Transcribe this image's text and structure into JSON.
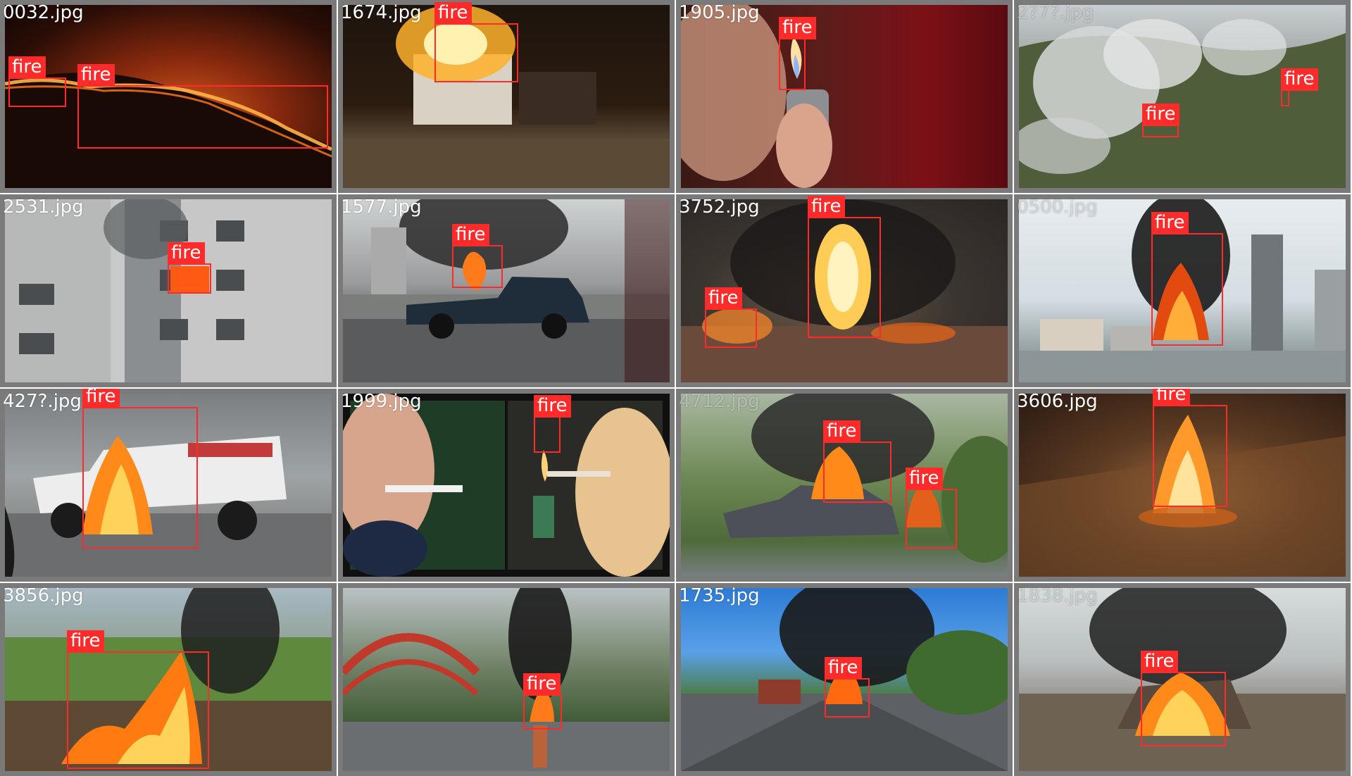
{
  "label_color": "#ff2b2b",
  "tiles": [
    {
      "filename": "0032.jpg",
      "filename_faint": false,
      "detections": [
        {
          "label": "fire"
        },
        {
          "label": "fire"
        }
      ]
    },
    {
      "filename": "1674.jpg",
      "filename_faint": false,
      "detections": [
        {
          "label": "fire"
        }
      ]
    },
    {
      "filename": "1905.jpg",
      "filename_faint": false,
      "detections": [
        {
          "label": "fire"
        }
      ]
    },
    {
      "filename": "2?7?.jpg",
      "filename_faint": true,
      "detections": [
        {
          "label": "fire"
        },
        {
          "label": "fire"
        }
      ]
    },
    {
      "filename": "2531.jpg",
      "filename_faint": false,
      "detections": [
        {
          "label": "fire"
        }
      ]
    },
    {
      "filename": "1577.jpg",
      "filename_faint": false,
      "detections": [
        {
          "label": "fire"
        }
      ]
    },
    {
      "filename": "3752.jpg",
      "filename_faint": false,
      "detections": [
        {
          "label": "fire"
        },
        {
          "label": "fire"
        }
      ]
    },
    {
      "filename": "0500.jpg",
      "filename_faint": true,
      "detections": [
        {
          "label": "fire"
        }
      ]
    },
    {
      "filename": "427?.jpg",
      "filename_faint": false,
      "detections": [
        {
          "label": "fire"
        }
      ]
    },
    {
      "filename": "1999.jpg",
      "filename_faint": false,
      "detections": [
        {
          "label": "fire"
        }
      ]
    },
    {
      "filename": "4712.jpg",
      "filename_faint": true,
      "detections": [
        {
          "label": "fire"
        },
        {
          "label": "fire"
        }
      ]
    },
    {
      "filename": "3606.jpg",
      "filename_faint": false,
      "detections": [
        {
          "label": "fire"
        }
      ]
    },
    {
      "filename": "3856.jpg",
      "filename_faint": false,
      "detections": [
        {
          "label": "fire"
        }
      ]
    },
    {
      "filename": "",
      "filename_faint": false,
      "detections": [
        {
          "label": "fire"
        }
      ]
    },
    {
      "filename": "1735.jpg",
      "filename_faint": false,
      "detections": [
        {
          "label": "fire"
        }
      ]
    },
    {
      "filename": "1838.jpg",
      "filename_faint": true,
      "detections": [
        {
          "label": "fire"
        }
      ]
    }
  ]
}
